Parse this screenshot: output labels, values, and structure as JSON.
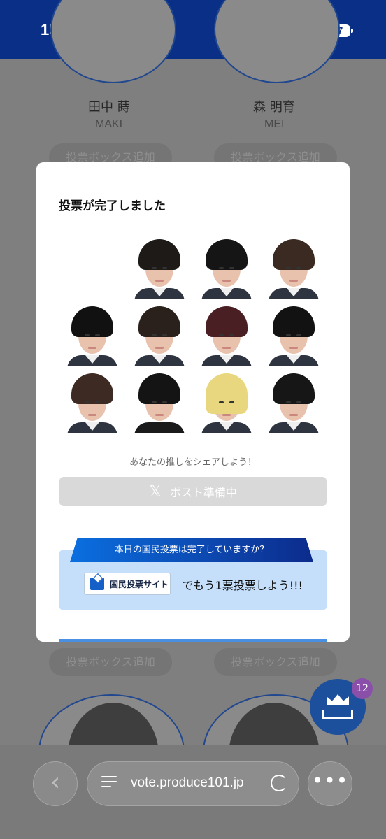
{
  "status_bar": {
    "time": "15:47",
    "battery": "67",
    "icons": [
      "moon-icon",
      "signal-icon",
      "wifi-icon",
      "battery-icon"
    ]
  },
  "background": {
    "members": [
      {
        "name": "田中 蒔",
        "roman": "MAKI"
      },
      {
        "name": "森 明育",
        "roman": "MEI"
      }
    ],
    "add_box_label": "投票ボックス追加"
  },
  "modal": {
    "title": "投票が完了しました",
    "share_prompt": "あなたの推しをシェアしよう！",
    "post_button": "ポスト準備中",
    "national_vote_question": "本日の国民投票は完了していますか？",
    "site_button": "国民投票サイト",
    "vote_again": "でもう1票投票しよう!!!"
  },
  "fab": {
    "badge_count": "12",
    "icon": "ballot-crown-icon"
  },
  "browser": {
    "url": "vote.produce101.jp",
    "icons": [
      "back-icon",
      "tabs-icon",
      "reload-icon",
      "more-icon"
    ]
  },
  "colors": {
    "status_bar": "#0a2f86",
    "accent_blue": "#1c4f9c",
    "badge_purple": "#8a4fa8",
    "banner_bg": "#c5dffa"
  }
}
